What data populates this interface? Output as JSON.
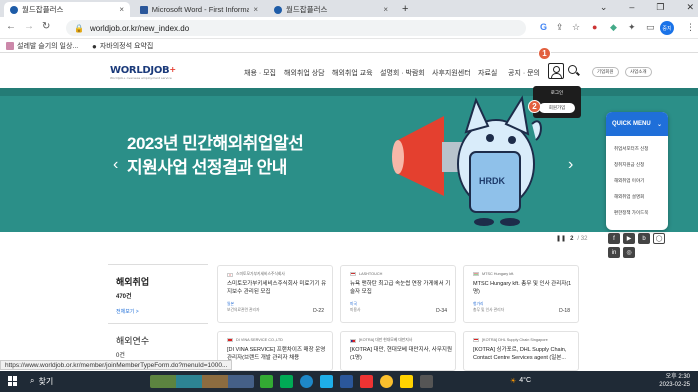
{
  "browser": {
    "tabs": [
      {
        "label": "월드잡플러스",
        "active": true
      },
      {
        "label": "Microsoft Word - First Informatio",
        "active": false
      },
      {
        "label": "월드잡플러스",
        "active": false
      }
    ],
    "new_tab": "+",
    "url": "worldjob.or.kr/new_index.do",
    "profile_label": "중지",
    "bookmarks": [
      "설레발 슬기의 일상...",
      "자바의정석 요약집"
    ]
  },
  "site": {
    "logo": "WORLDJOB",
    "logo_plus": "+",
    "logo_sub": "Worldjob+ overseas employment service",
    "nav": [
      "채용 · 모집",
      "해외취업 상담",
      "해외취업 교육",
      "설명회 · 박람회",
      "사후지원센터",
      "자료실",
      "공지 · 문의"
    ],
    "pills": [
      "기업회원",
      "사업소개"
    ],
    "badges": [
      "1",
      "2"
    ],
    "login_menu": {
      "login": "로그인",
      "join": "회원가입"
    }
  },
  "banner": {
    "line1": "2023년 민간해외취업알선",
    "line2": "지원사업 선정결과 안내",
    "mascot_text": "HRDK",
    "pager_current": "2",
    "pager_total": "/ 32",
    "pause": "❚❚"
  },
  "quick_menu": {
    "title": "QUICK MENU",
    "items": [
      "취업서포터즈 신청",
      "청취지원금 신청",
      "해외취업 이야기",
      "해외취업 설명회",
      "편한정책 가이드북"
    ]
  },
  "social": [
    "f",
    "▶",
    "b",
    "in",
    "◎",
    "◉"
  ],
  "jobs_panel": {
    "title": "해외취업",
    "count": "470건",
    "more": "전체보기 >",
    "title2": "해외연수",
    "count2": "0건"
  },
  "job_cards": [
    {
      "company": "스미토모가부키세비스주식회사",
      "title": "스미토모가부키세비스주식회사 미료기기 유지보수 관리된 모집",
      "loc": "일본",
      "cat": "보건의료관련 관리자",
      "dday": "D-22",
      "flag": "jp"
    },
    {
      "company": "LASHTOUCH",
      "title": "뉴욕 맨하탄 최고급 속눈썹 연장 가게에서 기술자 모집",
      "loc": "미국",
      "cat": "미용사",
      "dday": "D-34",
      "flag": "us"
    },
    {
      "company": "MTSC Hungary kft.",
      "title": "MTSC Hungary kft. 총무 및 인사 관리자(1명)",
      "loc": "헝가리",
      "cat": "총무 및 인사 관리자",
      "dday": "D-18",
      "flag": "hu"
    },
    {
      "company": "DI VINA SERVICE CO.,LTD",
      "title": "[DI VINA SERVICE] 프랜차이즈 매장 운영 관리자(브랜드 개발 관리자 채용",
      "loc": "",
      "cat": "",
      "dday": "",
      "flag": "vn"
    },
    {
      "company": "[KOTRA] 대만 현대모베 대만지사",
      "title": "[KOTRA] 대만, 현대모베 대만지사, 사무지원(1명)",
      "loc": "",
      "cat": "",
      "dday": "",
      "flag": "tw"
    },
    {
      "company": "[KOTRA] DHL Supply Chain Singapore",
      "title": "[KOTRA] 싱가포르, DHL Supply Chain, Contact Centre Services agent (일본...",
      "loc": "",
      "cat": "",
      "dday": "",
      "flag": "sg"
    }
  ],
  "status_url": "https://www.worldjob.or.kr/member/joinMemberTypeForm.do?menuId=1000...",
  "taskbar": {
    "search": "찾기",
    "weather": "4°C",
    "time": "오후 2:30",
    "date": "2023-02-25"
  },
  "colors": {
    "banner": "#2b8f88",
    "quickmenu": "#1f6fd9",
    "badge": "#e2603f"
  }
}
